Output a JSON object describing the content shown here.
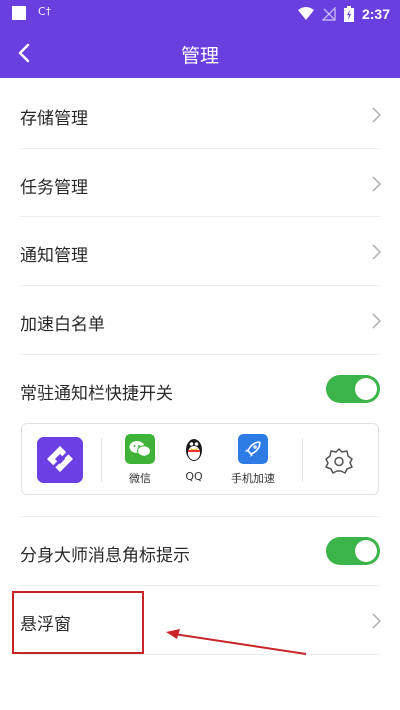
{
  "status_bar": {
    "carrier_text": "C†",
    "time": "2:37"
  },
  "toolbar": {
    "title": "管理",
    "back_icon": "back-arrow-icon"
  },
  "menu": {
    "storage": "存储管理",
    "tasks": "任务管理",
    "notifications": "通知管理",
    "whitelist": "加速白名单",
    "persistent_switch": "常驻通知栏快捷开关",
    "badge_hint": "分身大师消息角标提示",
    "floating_window": "悬浮窗"
  },
  "toggles": {
    "persistent_switch_on": true,
    "badge_hint_on": true
  },
  "quick_bar": {
    "items": [
      {
        "label": "微信",
        "icon": "wechat-icon"
      },
      {
        "label": "QQ",
        "icon": "qq-penguin-icon"
      },
      {
        "label": "手机加速",
        "icon": "rocket-icon"
      }
    ],
    "settings_icon": "gear-icon"
  },
  "colors": {
    "brand_purple": "#6a3fe0",
    "toggle_green": "#3bb44a",
    "annotation_red": "#c8242a"
  }
}
